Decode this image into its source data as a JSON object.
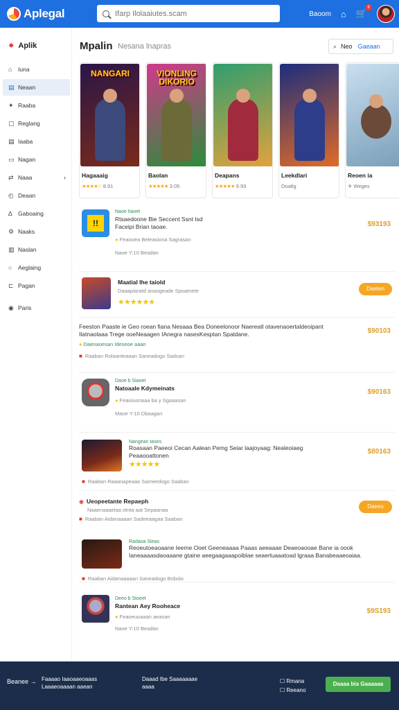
{
  "app": {
    "name": "Aplegal"
  },
  "search": {
    "placeholder": "Ifarp Ilolaaiutes.scam"
  },
  "topbar": {
    "link": "Baoom",
    "badge": "9"
  },
  "sidebar": {
    "title": "Aplik",
    "items": [
      {
        "label": "Iuna",
        "icon": "home-icon"
      },
      {
        "label": "Neaan",
        "icon": "tablet-icon"
      },
      {
        "label": "Raaba",
        "icon": "tag-icon"
      },
      {
        "label": "Reglang",
        "icon": "box-icon"
      },
      {
        "label": "Iaaba",
        "icon": "doc-icon"
      },
      {
        "label": "Nagan",
        "icon": "card-icon"
      },
      {
        "label": "Naaa",
        "icon": "shuffle-icon"
      },
      {
        "label": "Deaan",
        "icon": "clock-icon"
      },
      {
        "label": "Gaboaing",
        "icon": "person-icon"
      },
      {
        "label": "Naaks",
        "icon": "gear-icon"
      },
      {
        "label": "Naslan",
        "icon": "doc-icon"
      },
      {
        "label": "Aeglaing",
        "icon": "circle-icon"
      },
      {
        "label": "Pagan",
        "icon": "bracket-icon"
      },
      {
        "label": "Paris",
        "icon": "dot-icon"
      }
    ]
  },
  "main": {
    "title": "Mpalin",
    "subtitle": "Nesana lnapras",
    "filter": {
      "left": "Neo",
      "right": "Gaeaan"
    }
  },
  "cards": [
    {
      "title": "Hagaaaig",
      "art_word": "NANGARI",
      "rating": "★★★★☆",
      "meta": "8.91",
      "bg": [
        "#2a1648",
        "#7a2a1a"
      ],
      "hero": "#3b4a7a"
    },
    {
      "title": "Baolan",
      "art_word": "VIONLING DIKORIO",
      "rating": "★★★★★",
      "meta": "3.05",
      "bg": [
        "#d13a8c",
        "#2c8c3a"
      ],
      "hero": "#6d6a3a"
    },
    {
      "title": "Deapans",
      "art_word": "",
      "rating": "★★★★★",
      "meta": "9.93",
      "bg": [
        "#2f9e6e",
        "#e2a23d"
      ],
      "hero": "#a12b3d"
    },
    {
      "title": "Leekdlari",
      "art_word": "",
      "rating": "",
      "meta": "Doatlg",
      "bg": [
        "#1c2d7c",
        "#e06b27"
      ],
      "hero": "#2d3d8a"
    },
    {
      "title": "Reoen ia",
      "art_word": "",
      "rating": "",
      "meta": "Weges",
      "bg": [
        "#c9dfef",
        "#7a9fb8"
      ],
      "hero": "#6b4a3a"
    }
  ],
  "list": [
    {
      "type": "app",
      "tag": "Naoe Itaoet",
      "desc": "Rtsaedoone Bie Seccent Ssnt Isd Faceipi Brian taoae.",
      "meta": "Feaooea Beleasiona Sagrasan",
      "foot": "Naoe  Y:10  Beadan",
      "price": "$93193"
    },
    {
      "type": "button",
      "title": "Maatial Ihe taiold",
      "sub": "Daaapiaratd anaogeade  Spoatnete",
      "rating": "★★★★★★",
      "btn": "Daeten"
    },
    {
      "type": "text",
      "desc": "Feeston Paaste ie Geo roean fiana Nesaaa Bea Doneelonoor Naereatl otavenaoertaldeoipant Ilatnaolaaa Trege ooeNeaagen IAnegra nasesKesptan Spaldane.",
      "green": "Daenaoesan Ideseoe aaan",
      "foot": "Raaban  Rolaanteaaan  Saneadogo  Sadsan",
      "price": "$90103"
    },
    {
      "type": "app",
      "tag": "Daoe b Siaoet",
      "title": "Natoaale Kdymeinats",
      "meta": "Feaoiuonaaa ba y Sgaaasan",
      "foot": "Maoe  Y:10  Dbaagan",
      "price": "$90163"
    },
    {
      "type": "wide",
      "tag": "Nangean tases",
      "desc": "Roasaan Paeeoi Cecan Aalean Pemg Seiar laajoyaag: Nealeoiaeg Peaaooattonen",
      "rating": "★★★★★",
      "foot": "Raaban  Raaanapeaao  Sameedogo  Saaban",
      "price": "$80163"
    },
    {
      "type": "button",
      "title": "Ueopeetante Repaeph",
      "sub": "Naaenaaaelaa otnta aat Sepaanaa",
      "foot": "Raaban  Aidanaaaan  Sadeeaagaa  Saaban",
      "btn": "Daeeo"
    },
    {
      "type": "wide",
      "tag": "Radaoa Sieas",
      "desc": "Reoeutoeaoaane Ieeme Ooet Geeneaaaa Paaas aeeaaae Deaeoaooae Bane ia oook Ianeaaaasdaoaaane gtaine aeegaagaaapoiblae seaerluaaatoad lgraaa Banabeaaeoaiaa.",
      "foot": "Raaban  Aidanaaaaan  Saneadogo  Bobolo"
    },
    {
      "type": "app",
      "tag": "Deeo b Stoeet",
      "title": "Rantean Aey Rooheace",
      "meta": "Feaoeuoaaan aeasan",
      "foot": "Naoe  Y:10  Beadan",
      "price": "$9S193"
    }
  ],
  "footer": {
    "left": "Beanee",
    "col1": [
      "Faaaao Iaaoaaeoaaas",
      "Laaaeoaaaan aaean"
    ],
    "col2": [
      "Daaad Ibe Saaaaaaae",
      "aaaa"
    ],
    "right": [
      "Rmana",
      "Reeano"
    ],
    "button": "Daaaa bia Gaaaaaa"
  }
}
